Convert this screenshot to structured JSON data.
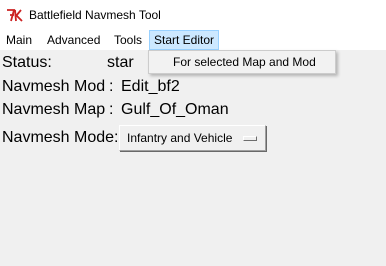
{
  "window": {
    "title": "Battlefield Navmesh Tool",
    "icon": "tk-feather-icon"
  },
  "menubar": {
    "items": [
      "Main",
      "Advanced",
      "Tools",
      "Start Editor"
    ],
    "active": "Start Editor"
  },
  "dropdown": {
    "items": [
      "For selected Map and Mod"
    ]
  },
  "fields": {
    "status": {
      "label": "Status:",
      "value": "star"
    },
    "mod": {
      "label": "Navmesh Mod",
      "sep": ":",
      "value": "Edit_bf2"
    },
    "map": {
      "label": "Navmesh Map",
      "sep": ":",
      "value": "Gulf_Of_Oman"
    },
    "mode": {
      "label": "Navmesh Mode:",
      "value": "Infantry and Vehicle"
    }
  },
  "colors": {
    "menu_highlight": "#cce8ff",
    "menu_highlight_border": "#99d1ff",
    "background": "#f0f0f0"
  }
}
